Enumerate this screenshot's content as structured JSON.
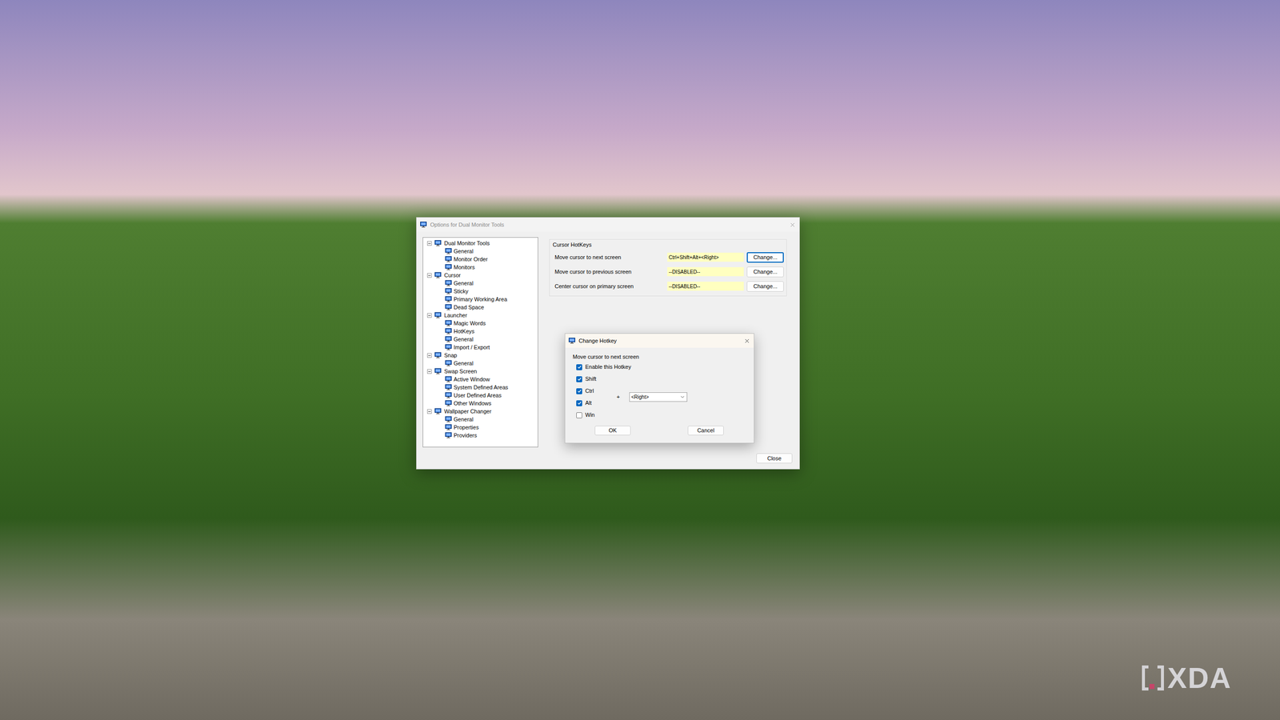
{
  "desktop": {
    "watermark": "XDA"
  },
  "window": {
    "title": "Options for Dual Monitor Tools",
    "close_button": "Close"
  },
  "tree": [
    {
      "label": "Dual Monitor Tools",
      "expanded": true,
      "selected": false,
      "children": [
        {
          "label": "General",
          "selected": false
        },
        {
          "label": "Monitor Order",
          "selected": false
        },
        {
          "label": "Monitors",
          "selected": false
        }
      ]
    },
    {
      "label": "Cursor",
      "expanded": true,
      "selected": false,
      "children": [
        {
          "label": "General",
          "selected": false
        },
        {
          "label": "Sticky",
          "selected": false
        },
        {
          "label": "Primary Working Area",
          "selected": false
        },
        {
          "label": "Dead Space",
          "selected": false
        }
      ]
    },
    {
      "label": "Launcher",
      "expanded": true,
      "selected": false,
      "children": [
        {
          "label": "Magic Words",
          "selected": false
        },
        {
          "label": "HotKeys",
          "selected": false
        },
        {
          "label": "General",
          "selected": false
        },
        {
          "label": "Import / Export",
          "selected": false
        }
      ]
    },
    {
      "label": "Snap",
      "expanded": true,
      "selected": false,
      "children": [
        {
          "label": "General",
          "selected": false
        }
      ]
    },
    {
      "label": "Swap Screen",
      "expanded": true,
      "selected": false,
      "children": [
        {
          "label": "Active Window",
          "selected": false
        },
        {
          "label": "System Defined Areas",
          "selected": false
        },
        {
          "label": "User Defined Areas",
          "selected": false
        },
        {
          "label": "Other Windows",
          "selected": false
        }
      ]
    },
    {
      "label": "Wallpaper Changer",
      "expanded": true,
      "selected": false,
      "children": [
        {
          "label": "General",
          "selected": false
        },
        {
          "label": "Properties",
          "selected": false
        },
        {
          "label": "Providers",
          "selected": false
        }
      ]
    }
  ],
  "group": {
    "title": "Cursor HotKeys",
    "rows": [
      {
        "label": "Move cursor to next screen",
        "value": "Ctrl+Shift+Alt+<Right>",
        "button": "Change...",
        "focused": true
      },
      {
        "label": "Move cursor to previous screen",
        "value": "--DISABLED--",
        "button": "Change...",
        "focused": false
      },
      {
        "label": "Center cursor on primary screen",
        "value": "--DISABLED--",
        "button": "Change...",
        "focused": false
      }
    ]
  },
  "dialog": {
    "title": "Change Hotkey",
    "action": "Move cursor to next screen",
    "enable": {
      "label": "Enable this Hotkey",
      "checked": true
    },
    "modifiers": [
      {
        "label": "Shift",
        "checked": true
      },
      {
        "label": "Ctrl",
        "checked": true
      },
      {
        "label": "Alt",
        "checked": true
      },
      {
        "label": "Win",
        "checked": false
      }
    ],
    "plus": "+",
    "key": "<Right>",
    "buttons": [
      "OK",
      "Cancel"
    ]
  }
}
